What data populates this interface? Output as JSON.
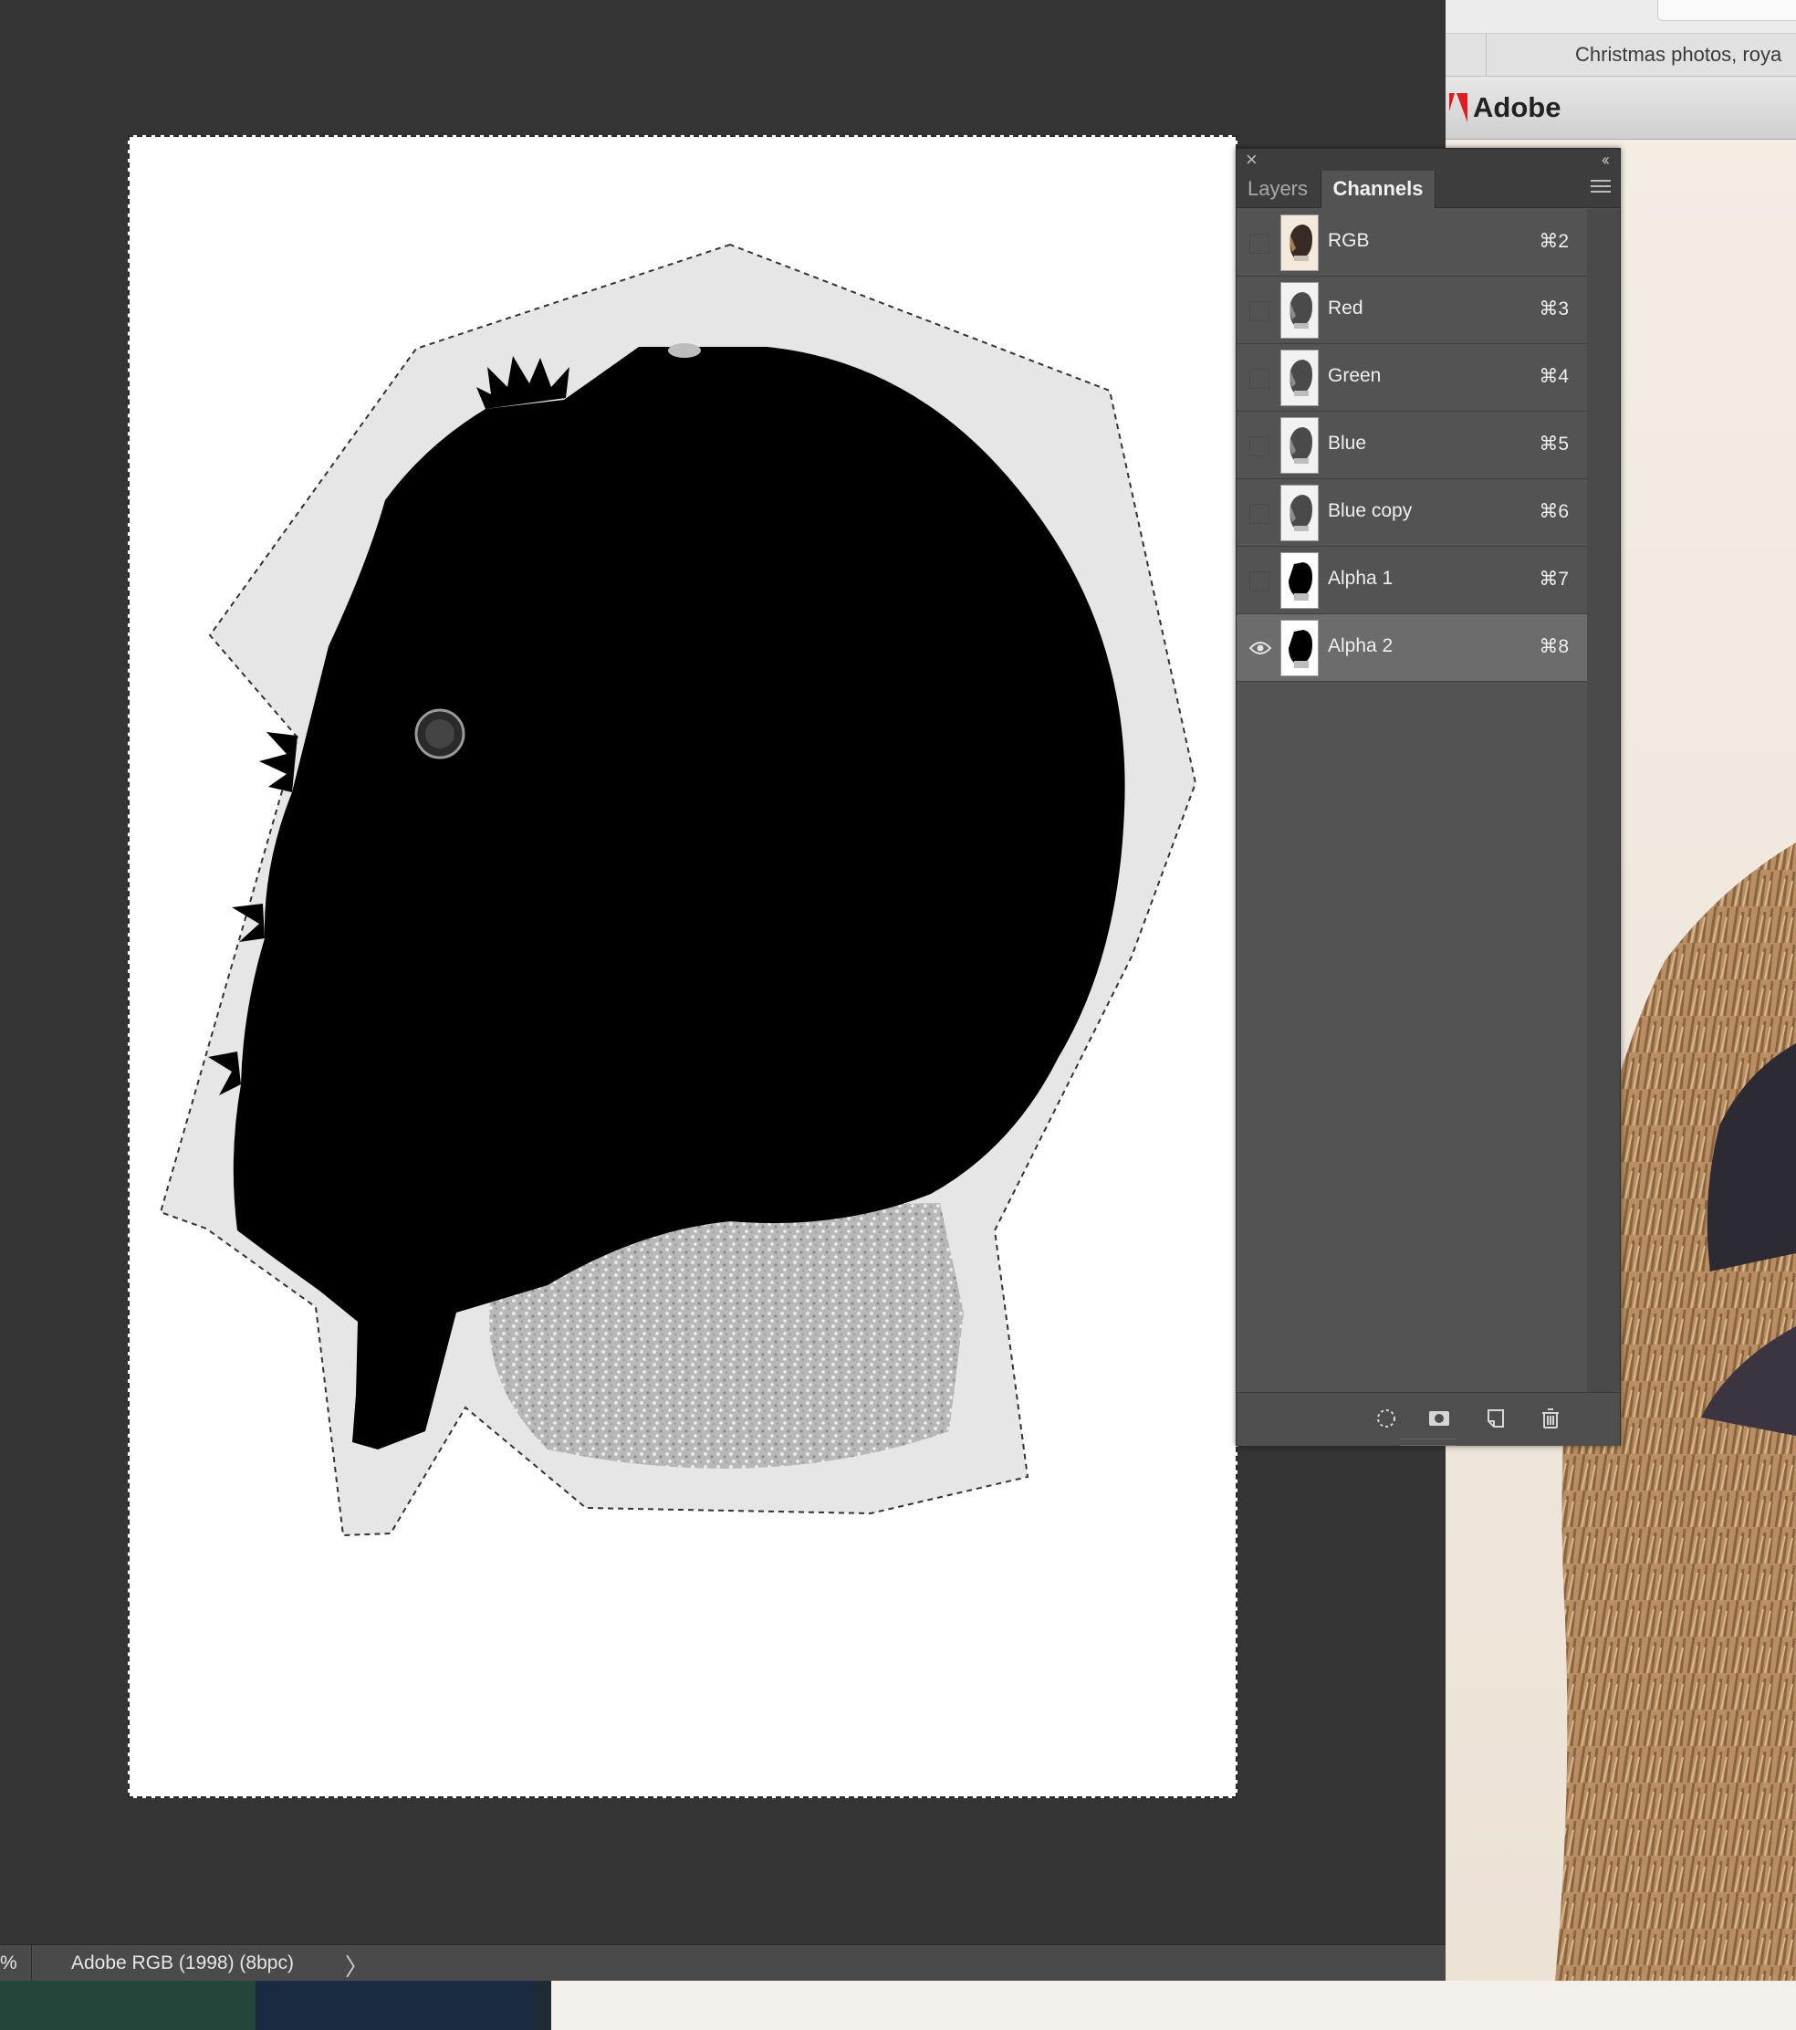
{
  "panel": {
    "tabs": [
      {
        "label": "Layers",
        "active": false
      },
      {
        "label": "Channels",
        "active": true
      }
    ],
    "channels": [
      {
        "name": "RGB",
        "shortcut": "⌘2",
        "visible": false,
        "selected": false,
        "thumb": "color"
      },
      {
        "name": "Red",
        "shortcut": "⌘3",
        "visible": false,
        "selected": false,
        "thumb": "gray"
      },
      {
        "name": "Green",
        "shortcut": "⌘4",
        "visible": false,
        "selected": false,
        "thumb": "gray"
      },
      {
        "name": "Blue",
        "shortcut": "⌘5",
        "visible": false,
        "selected": false,
        "thumb": "gray"
      },
      {
        "name": "Blue copy",
        "shortcut": "⌘6",
        "visible": false,
        "selected": false,
        "thumb": "gray"
      },
      {
        "name": "Alpha 1",
        "shortcut": "⌘7",
        "visible": false,
        "selected": false,
        "thumb": "mask"
      },
      {
        "name": "Alpha 2",
        "shortcut": "⌘8",
        "visible": true,
        "selected": true,
        "thumb": "mask"
      }
    ],
    "footer_icons": [
      "load-selection-icon",
      "save-selection-icon",
      "new-channel-icon",
      "trash-icon"
    ]
  },
  "statusbar": {
    "zoom_fragment": "%",
    "color_profile": "Adobe RGB (1998) (8bpc)",
    "arrow": "〉"
  },
  "browser": {
    "tab_title": "Christmas photos, roya",
    "brand": "Adobe",
    "brand_color": "#e01d1d"
  }
}
